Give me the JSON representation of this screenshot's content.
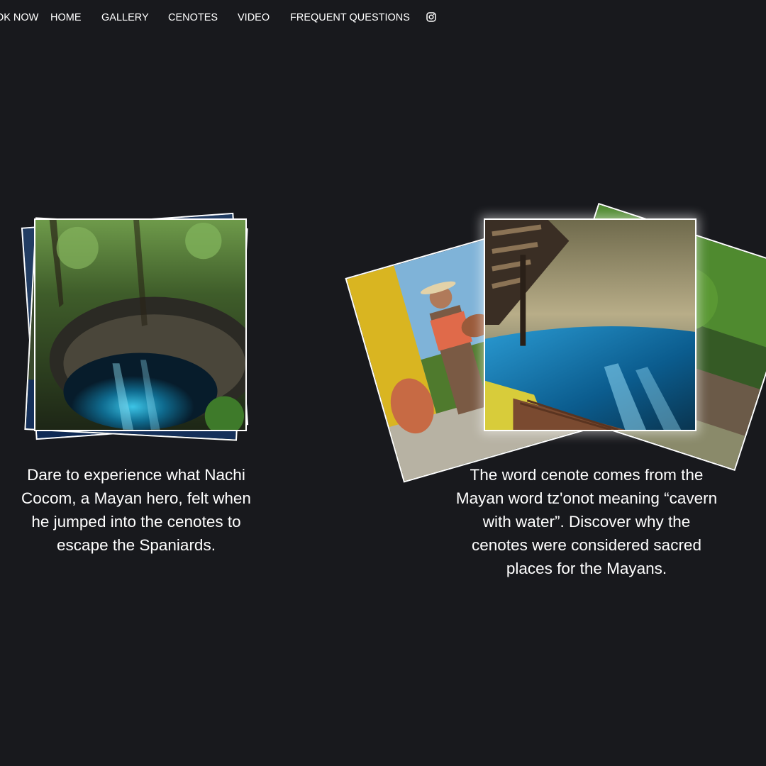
{
  "nav": {
    "book_now": "BOOK NOW",
    "home": "HOME",
    "gallery": "GALLERY",
    "cenotes": "CENOTES",
    "video": "VIDEO",
    "faq": "FREQUENT QUESTIONS",
    "instagram_icon": "instagram-icon"
  },
  "cards": [
    {
      "caption": "Dare to experience what Nachi Cocom, a Mayan hero, felt when he jumped into the cenotes to escape the Spaniards."
    },
    {
      "caption": "The word cenote comes from the Mayan word tz'onot meaning “cavern with water”. Discover why the cenotes were considered sacred places for the Mayans."
    }
  ],
  "colors": {
    "background": "#18191d",
    "text": "#ffffff",
    "photo_border": "#ffffff"
  }
}
